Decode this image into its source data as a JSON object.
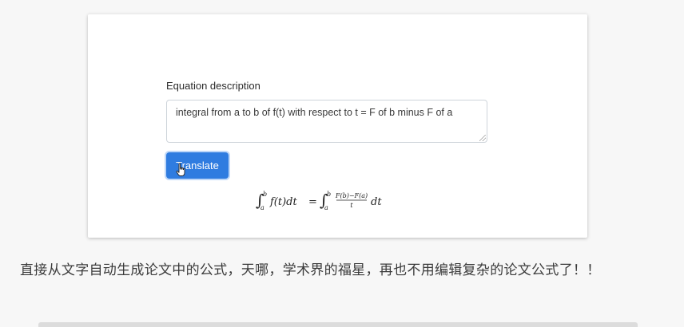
{
  "form": {
    "label": "Equation description",
    "textarea_value": "integral from a to b of f(t) with respect to t = F of b minus F of a",
    "button_label": "Translate"
  },
  "formula": {
    "lhs_integral": "∫",
    "lower": "a",
    "upper": "b",
    "lhs_body": "f(t)dt",
    "equals": "=",
    "rhs_integral": "∫",
    "frac_num": "F(b)−F(a)",
    "frac_den": "t",
    "rhs_tail": "dt"
  },
  "caption": "直接从文字自动生成论文中的公式，天哪，学术界的福星，再也不用编辑复杂的论文公式了！！",
  "colors": {
    "button": "#2f7ce0",
    "page_bg": "#f7f7f7"
  }
}
